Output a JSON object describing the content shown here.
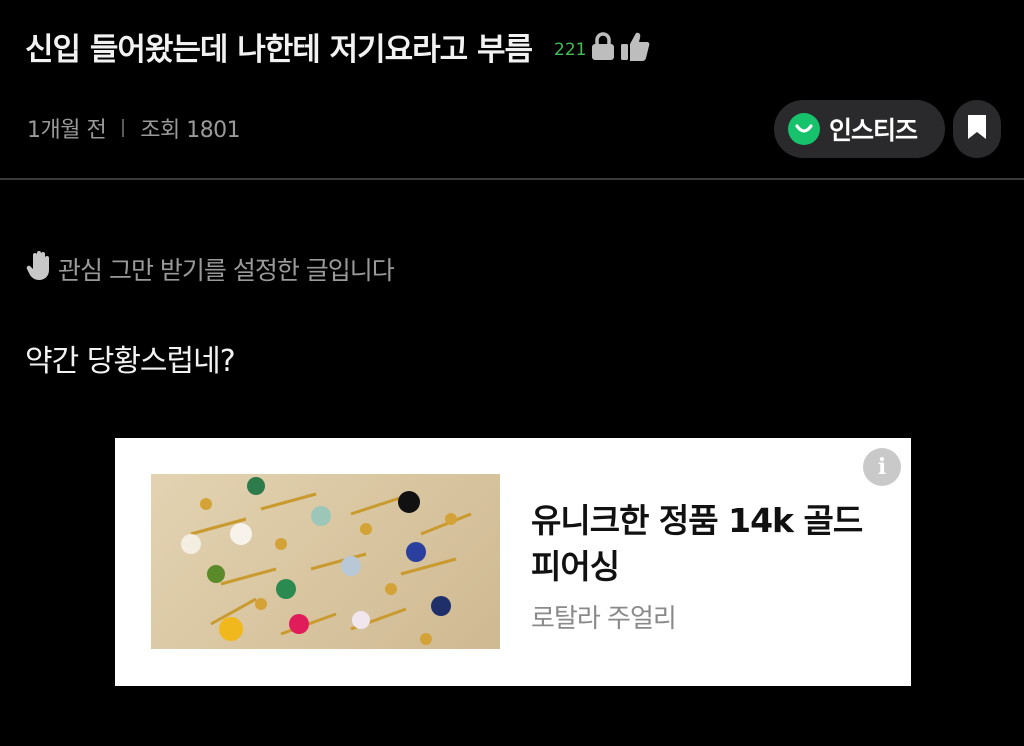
{
  "post": {
    "title": "신입 들어왔는데 나한테 저기요라고 부름",
    "like_count": "221",
    "time_ago": "1개월 전",
    "views_label": "조회 1801",
    "notice": "관심 그만 받기를 설정한 글입니다",
    "body": "약간 당황스럽네?"
  },
  "community": {
    "name": "인스티즈",
    "logo_color": "#16c26b"
  },
  "ad": {
    "headline": "유니크한 정품 14k 골드 피어싱",
    "advertiser": "로탈라 주얼리",
    "info_icon": "i"
  },
  "icons": {
    "lock": "lock-icon",
    "thumb": "thumbs-up-icon",
    "bookmark": "bookmark-icon",
    "hand": "raised-hand-icon",
    "info": "info-icon"
  },
  "colors": {
    "background": "#000000",
    "like_count": "#3fbf55",
    "meta_text": "#9a9a9a",
    "pill_bg": "#2a2a2c"
  }
}
